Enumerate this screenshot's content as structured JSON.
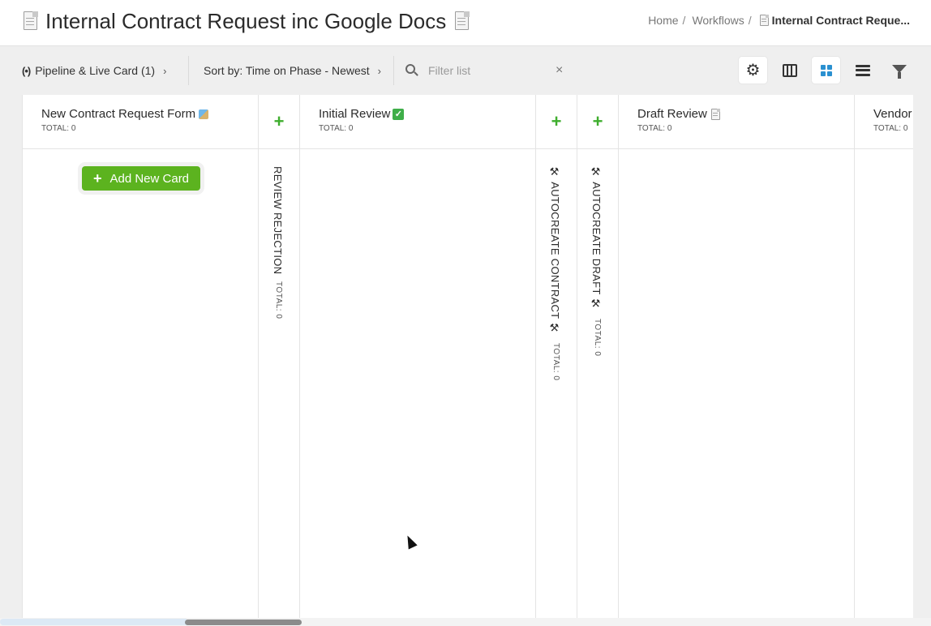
{
  "header": {
    "title": "Internal Contract Request inc Google Docs",
    "breadcrumb": {
      "home": "Home",
      "sep1": "/",
      "workflows": "Workflows",
      "sep2": "/",
      "current": "Internal Contract Reque..."
    }
  },
  "toolbar": {
    "pipeline_label": "Pipeline & Live Card (1)",
    "sort_label": "Sort by: Time on Phase - Newest",
    "filter_placeholder": "Filter list",
    "clear_symbol": "×",
    "chevron": "›",
    "radio_symbol": "(•)",
    "gear_symbol": "⚙"
  },
  "board": {
    "columns": [
      {
        "title": "New Contract Request Form",
        "total": "TOTAL: 0",
        "emoji": "ballot-box-icon"
      },
      {
        "title": "REVIEW REJECTION",
        "total": "TOTAL: 0",
        "collapsed": true
      },
      {
        "title": "Initial Review",
        "total": "TOTAL: 0",
        "emoji": "check-mark-icon"
      },
      {
        "title": "AUTOCREATE CONTRACT",
        "total": "TOTAL: 0",
        "collapsed": true,
        "icon": "tools-icon"
      },
      {
        "title": "AUTOCREATE DRAFT",
        "total": "TOTAL: 0",
        "collapsed": true,
        "icon": "tools-icon"
      },
      {
        "title": "Draft Review",
        "total": "TOTAL: 0",
        "emoji": "document-icon"
      },
      {
        "title": "Vendor",
        "total": "TOTAL: 0"
      }
    ],
    "add_card_label": "Add New Card",
    "plus_symbol": "+",
    "check_symbol": "✓",
    "tools_symbol": "⚒"
  },
  "colors": {
    "accent_green": "#5cb31f",
    "plus_green": "#3fae2e",
    "active_view_blue": "#2a90d0"
  }
}
